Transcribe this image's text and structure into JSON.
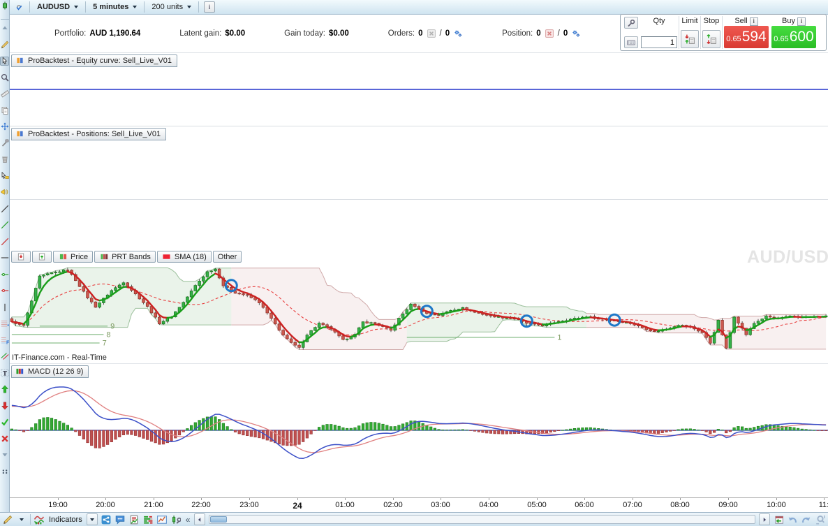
{
  "top_toolbar": {
    "instrument": "AUDUSD",
    "timeframe": "5 minutes",
    "units": "200 units",
    "info_icon": "i"
  },
  "portfolio_bar": {
    "portfolio_label": "Portfolio:",
    "portfolio_value": "AUD 1,190.64",
    "latent_gain_label": "Latent gain:",
    "latent_gain_value": "$0.00",
    "gain_today_label": "Gain today:",
    "gain_today_value": "$0.00",
    "orders_label": "Orders:",
    "orders_count": "0",
    "orders_pending": "0",
    "position_label": "Position:",
    "position_count": "0",
    "position_pending": "0",
    "sep": "/"
  },
  "order_panel": {
    "qty_label": "Qty",
    "qty_value": "1",
    "limit_label": "Limit",
    "stop_label": "Stop",
    "sell_label": "Sell",
    "buy_label": "Buy",
    "info_glyph": "i",
    "sell_price_small": "0.65",
    "sell_price_big": "594",
    "buy_price_small": "0.65",
    "buy_price_big": "600"
  },
  "panels": {
    "equity": {
      "title": "ProBacktest - Equity curve: Sell_Live_V01"
    },
    "positions": {
      "title": "ProBacktest - Positions: Sell_Live_V01"
    },
    "macd": {
      "title": "MACD (12 26 9)"
    }
  },
  "price_legend": {
    "price": "Price",
    "bands": "PRT Bands",
    "sma": "SMA (18)",
    "other": "Other"
  },
  "watermark": "AUD/USD Min",
  "datafeed": "IT-Finance.com - Real-Time",
  "bottom_toolbar": {
    "indicators_label": "Indicators",
    "collapse_glyph": "«"
  },
  "colors": {
    "sell_red": "#dd3c34",
    "buy_green": "#2cc026",
    "equity_line": "#2233cc",
    "candle_up": "#35b04a",
    "candle_down": "#cc5a50",
    "sma_line": "#e84040",
    "band_up_fill": "rgba(90,160,90,0.13)",
    "band_down_fill": "rgba(190,110,110,0.10)",
    "macd_line": "#3c50c8",
    "signal_line": "#e08080",
    "hist_up": "#33aa33",
    "hist_down": "#c05050",
    "signal_circle": "#1e78c8",
    "level_line": "#6faf6f"
  },
  "left_toolbar": {
    "items": [
      {
        "name": "chart-style-candlestick-icon",
        "icon": "candle"
      },
      {
        "name": "toolbar-scroll-up-icon",
        "icon": "scroll-up"
      },
      {
        "name": "draw-pencil-icon",
        "icon": "pencil"
      },
      {
        "name": "select-cursor-icon",
        "icon": "cursor",
        "selected": true
      },
      {
        "name": "zoom-tool-icon",
        "icon": "magnifier"
      },
      {
        "name": "measure-ruler-icon",
        "icon": "ruler"
      },
      {
        "name": "duplicate-icon",
        "icon": "copy"
      },
      {
        "name": "move-tool-icon",
        "icon": "move"
      },
      {
        "name": "settings-tools-icon",
        "icon": "tools"
      },
      {
        "name": "delete-trash-icon",
        "icon": "trash"
      },
      {
        "name": "pointer-flag-icon",
        "icon": "pointer-flag"
      },
      {
        "name": "alerts-icon",
        "icon": "alert"
      },
      {
        "name": "trendline-icon",
        "icon": "line"
      },
      {
        "name": "trendline-up-icon",
        "icon": "line-green"
      },
      {
        "name": "trendline-down-icon",
        "icon": "line-red"
      },
      {
        "name": "horizontal-line-icon",
        "icon": "hline"
      },
      {
        "name": "support-level-icon",
        "icon": "hline-green"
      },
      {
        "name": "resistance-level-icon",
        "icon": "hline-red"
      },
      {
        "name": "vertical-line-icon",
        "icon": "vline"
      },
      {
        "name": "fibonacci-retracement-icon",
        "icon": "fib"
      },
      {
        "name": "fibonacci-fan-icon",
        "icon": "fib-f"
      },
      {
        "name": "channel-icon",
        "icon": "channel"
      },
      {
        "name": "text-note-icon",
        "icon": "text"
      },
      {
        "name": "buy-marker-icon",
        "icon": "arrow-up"
      },
      {
        "name": "sell-marker-icon",
        "icon": "arrow-down"
      },
      {
        "name": "validate-icon",
        "icon": "check"
      },
      {
        "name": "remove-icon",
        "icon": "cross"
      },
      {
        "name": "toolbar-scroll-down-icon",
        "icon": "scroll-down"
      },
      {
        "name": "more-options-icon",
        "icon": "dots"
      }
    ]
  },
  "chart_data": [
    {
      "type": "candlestick",
      "title": "AUD/USD 5 minutes, 200 units",
      "candles_count": 205,
      "last_price": 0.65594,
      "x_axis_ticks": [
        {
          "label": "19:00",
          "idx": 11.5
        },
        {
          "label": "20:00",
          "idx": 23.5
        },
        {
          "label": "21:00",
          "idx": 35.5
        },
        {
          "label": "22:00",
          "idx": 47.5
        },
        {
          "label": "23:00",
          "idx": 59.5
        },
        {
          "label": "24",
          "idx": 71.5,
          "bold": true
        },
        {
          "label": "01:00",
          "idx": 83.5
        },
        {
          "label": "02:00",
          "idx": 95.5
        },
        {
          "label": "03:00",
          "idx": 107.5
        },
        {
          "label": "04:00",
          "idx": 119.5
        },
        {
          "label": "05:00",
          "idx": 131.5
        },
        {
          "label": "06:00",
          "idx": 143.5
        },
        {
          "label": "07:00",
          "idx": 155.5
        },
        {
          "label": "08:00",
          "idx": 167.5
        },
        {
          "label": "09:00",
          "idx": 179.5
        },
        {
          "label": "10:00",
          "idx": 191.5
        },
        {
          "label": "11:",
          "idx": 203.5
        }
      ],
      "price_waypoints": [
        [
          0,
          0.6556
        ],
        [
          3,
          0.65539
        ],
        [
          7,
          0.65836
        ],
        [
          10,
          0.65857
        ],
        [
          14,
          0.65878
        ],
        [
          16,
          0.65814
        ],
        [
          19,
          0.65708
        ],
        [
          21,
          0.65653
        ],
        [
          25,
          0.65751
        ],
        [
          28,
          0.65802
        ],
        [
          31,
          0.6573
        ],
        [
          34,
          0.65653
        ],
        [
          37,
          0.65552
        ],
        [
          40,
          0.65594
        ],
        [
          43,
          0.65679
        ],
        [
          46,
          0.65781
        ],
        [
          49,
          0.65865
        ],
        [
          51,
          0.65882
        ],
        [
          53,
          0.65781
        ],
        [
          56,
          0.65738
        ],
        [
          59,
          0.65721
        ],
        [
          62,
          0.65679
        ],
        [
          65,
          0.65581
        ],
        [
          67,
          0.65509
        ],
        [
          70,
          0.65433
        ],
        [
          72,
          0.65403
        ],
        [
          74,
          0.65484
        ],
        [
          77,
          0.65552
        ],
        [
          80,
          0.65518
        ],
        [
          83,
          0.6545
        ],
        [
          86,
          0.65484
        ],
        [
          88,
          0.6556
        ],
        [
          91,
          0.65552
        ],
        [
          95,
          0.65509
        ],
        [
          97,
          0.65581
        ],
        [
          100,
          0.65666
        ],
        [
          101,
          0.65658
        ],
        [
          104,
          0.65611
        ],
        [
          107,
          0.65602
        ],
        [
          110,
          0.65632
        ],
        [
          113,
          0.65645
        ],
        [
          116,
          0.65619
        ],
        [
          119,
          0.65602
        ],
        [
          122,
          0.6559
        ],
        [
          126,
          0.65581
        ],
        [
          129,
          0.65552
        ],
        [
          133,
          0.65539
        ],
        [
          137,
          0.65564
        ],
        [
          141,
          0.65581
        ],
        [
          144,
          0.65594
        ],
        [
          147,
          0.65581
        ],
        [
          151,
          0.65568
        ],
        [
          155,
          0.65552
        ],
        [
          158,
          0.65526
        ],
        [
          161,
          0.65501
        ],
        [
          164,
          0.65518
        ],
        [
          167,
          0.65543
        ],
        [
          170,
          0.6553
        ],
        [
          173,
          0.65496
        ],
        [
          175,
          0.65433
        ],
        [
          177,
          0.65568
        ],
        [
          179,
          0.65399
        ],
        [
          181,
          0.65594
        ],
        [
          184,
          0.65484
        ],
        [
          186,
          0.65552
        ],
        [
          189,
          0.65594
        ],
        [
          192,
          0.65581
        ],
        [
          195,
          0.65594
        ],
        [
          198,
          0.6559
        ],
        [
          201,
          0.65591
        ],
        [
          204,
          0.65594
        ]
      ],
      "sma_period": 18,
      "band_window": 26,
      "trend_segments": [
        [
          0,
          55,
          "up"
        ],
        [
          55,
          99,
          "down"
        ],
        [
          99,
          144,
          "up"
        ],
        [
          144,
          205,
          "down"
        ]
      ],
      "signal_circles": [
        55,
        104,
        129,
        151
      ],
      "level_lines": [
        {
          "label": "9",
          "from": 7,
          "to": 24,
          "price": 0.65535
        },
        {
          "label": "8",
          "from": 0,
          "to": 23,
          "price": 0.65484
        },
        {
          "label": "7",
          "from": 0,
          "to": 22,
          "price": 0.65433
        },
        {
          "label": "1",
          "from": 99,
          "to": 136,
          "price": 0.65467
        }
      ]
    },
    {
      "type": "line",
      "title": "ProBacktest equity curve",
      "series": [
        {
          "name": "Equity",
          "values": [
            1190.64,
            1190.64
          ],
          "note": "flat horizontal line"
        }
      ]
    },
    {
      "type": "macd",
      "title": "MACD (12 26 9)",
      "params": {
        "fast": 12,
        "slow": 26,
        "signal": 9
      },
      "note": "derived from candlestick closes; histogram = macd - signal, blue macd line, pink signal line, blue zero line"
    }
  ]
}
